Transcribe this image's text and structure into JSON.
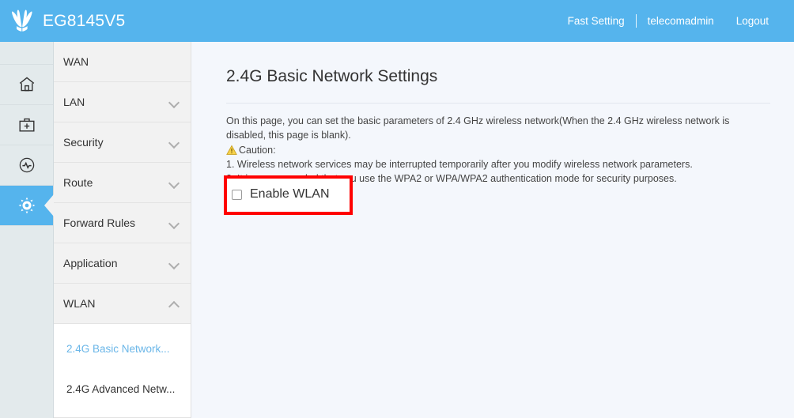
{
  "header": {
    "logo_icon": "huawei-logo-icon",
    "brand_name": "EG8145V5",
    "fast_setting": "Fast Setting",
    "username": "telecomadmin",
    "logout": "Logout"
  },
  "icon_rail": {
    "items": [
      {
        "icon": "home-icon",
        "name": "home",
        "active": false
      },
      {
        "icon": "first-aid-kit-icon",
        "name": "diagnosis",
        "active": false
      },
      {
        "icon": "gauge-icon",
        "name": "status",
        "active": false
      },
      {
        "icon": "gear-icon",
        "name": "settings",
        "active": true
      }
    ]
  },
  "menu": {
    "items": [
      {
        "label": "WAN",
        "chevron": "none"
      },
      {
        "label": "LAN",
        "chevron": "down"
      },
      {
        "label": "Security",
        "chevron": "down"
      },
      {
        "label": "Route",
        "chevron": "down"
      },
      {
        "label": "Forward Rules",
        "chevron": "down"
      },
      {
        "label": "Application",
        "chevron": "down"
      },
      {
        "label": "WLAN",
        "chevron": "up"
      }
    ],
    "submenu": [
      {
        "label": "2.4G Basic Network...",
        "active": true
      },
      {
        "label": "2.4G Advanced Netw...",
        "active": false
      }
    ]
  },
  "main": {
    "title": "2.4G Basic Network Settings",
    "desc_line1": "On this page, you can set the basic parameters of 2.4 GHz wireless network(When the 2.4 GHz wireless network is disabled, this page is blank).",
    "caution_icon": "warning-triangle-icon",
    "caution_label": "Caution:",
    "caution_item1": "1. Wireless network services may be interrupted temporarily after you modify wireless network parameters.",
    "caution_item2": "2. It is recommended that you use the WPA2 or WPA/WPA2 authentication mode for security purposes.",
    "enable_wlan_label": "Enable WLAN",
    "enable_wlan_checked": false
  },
  "colors": {
    "header_blue": "#55b4ed",
    "accent_link": "#6ab6e8",
    "highlight_red": "#ff0000",
    "content_bg": "#f4f7fc",
    "menu_bg": "#f2f2f2",
    "rail_bg": "#e3eaec",
    "warning_yellow": "#f4c430"
  }
}
